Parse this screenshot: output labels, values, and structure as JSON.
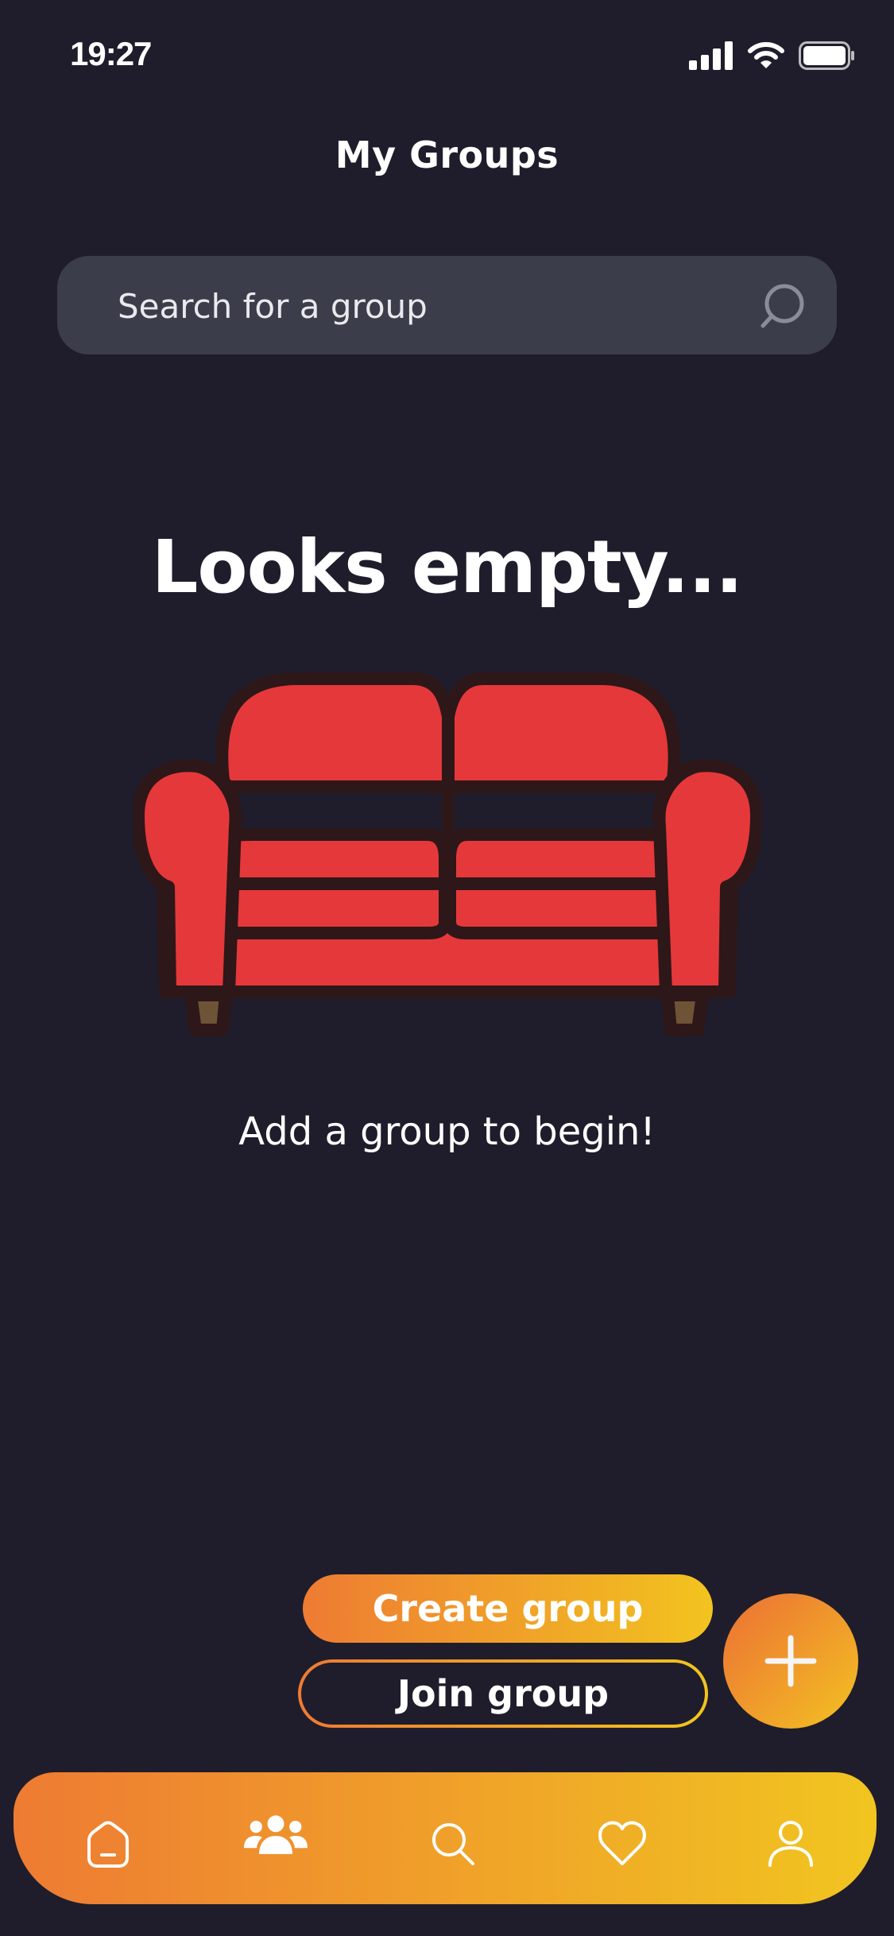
{
  "status_bar": {
    "time": "19:27",
    "icons": [
      "cellular-signal-icon",
      "wifi-icon",
      "battery-icon"
    ]
  },
  "header": {
    "title": "My Groups"
  },
  "search": {
    "placeholder": "Search for a group",
    "value": "",
    "icon": "search-icon"
  },
  "empty_state": {
    "title": "Looks empty...",
    "illustration": "sofa-illustration",
    "subtitle": "Add a group to begin!"
  },
  "actions": {
    "create_label": "Create group",
    "join_label": "Join group",
    "fab_icon": "plus-icon"
  },
  "tab_bar": {
    "tabs": [
      {
        "icon": "home-icon"
      },
      {
        "icon": "groups-icon",
        "active": true
      },
      {
        "icon": "search-icon"
      },
      {
        "icon": "heart-icon"
      },
      {
        "icon": "profile-icon"
      }
    ]
  },
  "colors": {
    "background": "#1f1d2b",
    "search_field": "#3b3e4a",
    "gradient_start": "#ee7b33",
    "gradient_end": "#f2c41f",
    "sofa_red": "#e5383b",
    "sofa_outline": "#2e1718"
  }
}
